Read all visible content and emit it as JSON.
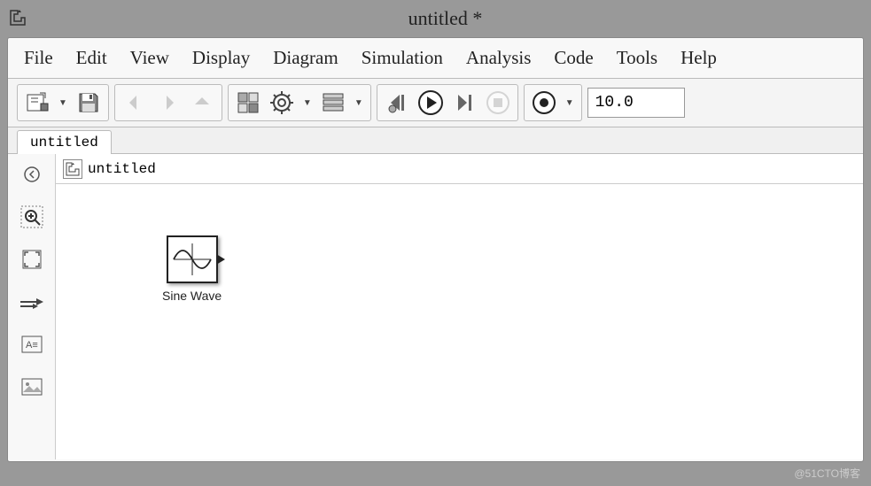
{
  "title": "untitled *",
  "menu": [
    "File",
    "Edit",
    "View",
    "Display",
    "Diagram",
    "Simulation",
    "Analysis",
    "Code",
    "Tools",
    "Help"
  ],
  "toolbar": {
    "time_value": "10.0"
  },
  "tab": {
    "label": "untitled"
  },
  "path": {
    "label": "untitled"
  },
  "block": {
    "label": "Sine Wave"
  },
  "watermark": "@51CTO博客"
}
